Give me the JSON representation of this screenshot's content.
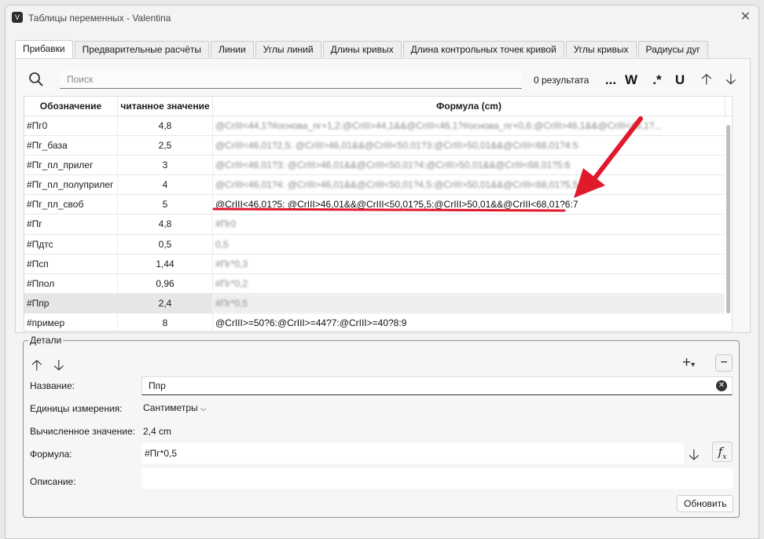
{
  "window": {
    "title": "Таблицы переменных - Valentina"
  },
  "tabs": [
    {
      "label": "Прибавки",
      "active": true
    },
    {
      "label": "Предварительные расчёты"
    },
    {
      "label": "Линии"
    },
    {
      "label": "Углы линий"
    },
    {
      "label": "Длины кривых"
    },
    {
      "label": "Длина контрольных точек кривой"
    },
    {
      "label": "Углы кривых"
    },
    {
      "label": "Радиусы дуг"
    }
  ],
  "search": {
    "placeholder": "Поиск",
    "results": "0 результата"
  },
  "toolbar": {
    "dots": "...",
    "whole_word": "W",
    "regex": ".*",
    "match_case": "U"
  },
  "table": {
    "columns": [
      "Обозначение",
      "читанное значение",
      "Формула (cm)"
    ],
    "rows": [
      {
        "name": "#Пг0",
        "value": "4,8",
        "formula": "@CrIII<44,1?#основа_пг+1,2:@CrIII>44,1&&@CrIII<46,1?#основа_пг+0,6:@CrIII>46,1&&@CrIII<48,1?...",
        "blurred": true
      },
      {
        "name": "#Пг_база",
        "value": "2,5",
        "formula": "@CrIII<46,01?2,5: @CrIII>46,01&&@CrIII<50,01?3:@CrIII>50,01&&@CrIII<68,01?4:5",
        "blurred": true
      },
      {
        "name": "#Пг_пл_прилег",
        "value": "3",
        "formula": "@CrIII<46,01?3: @CrIII>46,01&&@CrIII<50,01?4:@CrIII>50,01&&@CrIII<68,01?5:6",
        "blurred": true
      },
      {
        "name": "#Пг_пл_полуприлег",
        "value": "4",
        "formula": "@CrIII<46,01?4: @CrIII>46,01&&@CrIII<50,01?4,5:@CrIII>50,01&&@CrIII<68,01?5,5:6,5",
        "blurred": true
      },
      {
        "name": "#Пг_пл_своб",
        "value": "5",
        "formula": "@CrIII<46,01?5: @CrIII>46,01&&@CrIII<50,01?5,5:@CrIII>50,01&&@CrIII<68,01?6:7",
        "blurred": false
      },
      {
        "name": "#Пг",
        "value": "4,8",
        "formula": "#Пг0",
        "blurred": true
      },
      {
        "name": "#Пдтс",
        "value": "0,5",
        "formula": "0,5",
        "blurred": true
      },
      {
        "name": "#Псп",
        "value": "1,44",
        "formula": "#Пг*0,3",
        "blurred": true
      },
      {
        "name": "#Ппол",
        "value": "0,96",
        "formula": "#Пг*0,2",
        "blurred": true
      },
      {
        "name": "#Ппр",
        "value": "2,4",
        "formula": "#Пг*0,5",
        "blurred": true,
        "selected": true
      },
      {
        "name": "#пример",
        "value": "8",
        "formula": "@CrIII>=50?6:@CrIII>=44?7:@CrIII>=40?8:9",
        "blurred": false
      }
    ]
  },
  "details": {
    "legend": "Детали",
    "name_label": "Название:",
    "name_value": "Ппр",
    "units_label": "Единицы измерения:",
    "units_value": "Сантиметры",
    "calc_label": "Вычисленное значение:",
    "calc_value": "2,4 cm",
    "formula_label": "Формула:",
    "formula_value": "#Пг*0,5",
    "description_label": "Описание:",
    "update_button": "Обновить"
  },
  "colors": {
    "annotation": "#e0192b",
    "selected_row": "#e6e6e6"
  },
  "icons": [
    "app-icon",
    "close-icon",
    "search-icon",
    "arrow-up-icon",
    "arrow-down-icon",
    "plus-icon",
    "minus-icon",
    "clear-icon",
    "fx-icon",
    "chevron-down-icon"
  ]
}
